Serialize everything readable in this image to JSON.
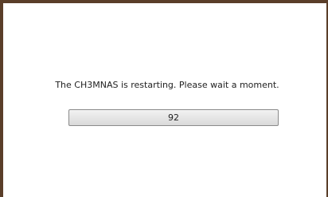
{
  "dialog": {
    "message": "The CH3MNAS is restarting. Please wait a moment.",
    "countdown": "92"
  },
  "colors": {
    "frame_border": "#5a3e29",
    "background": "#ffffff",
    "text": "#222222"
  }
}
